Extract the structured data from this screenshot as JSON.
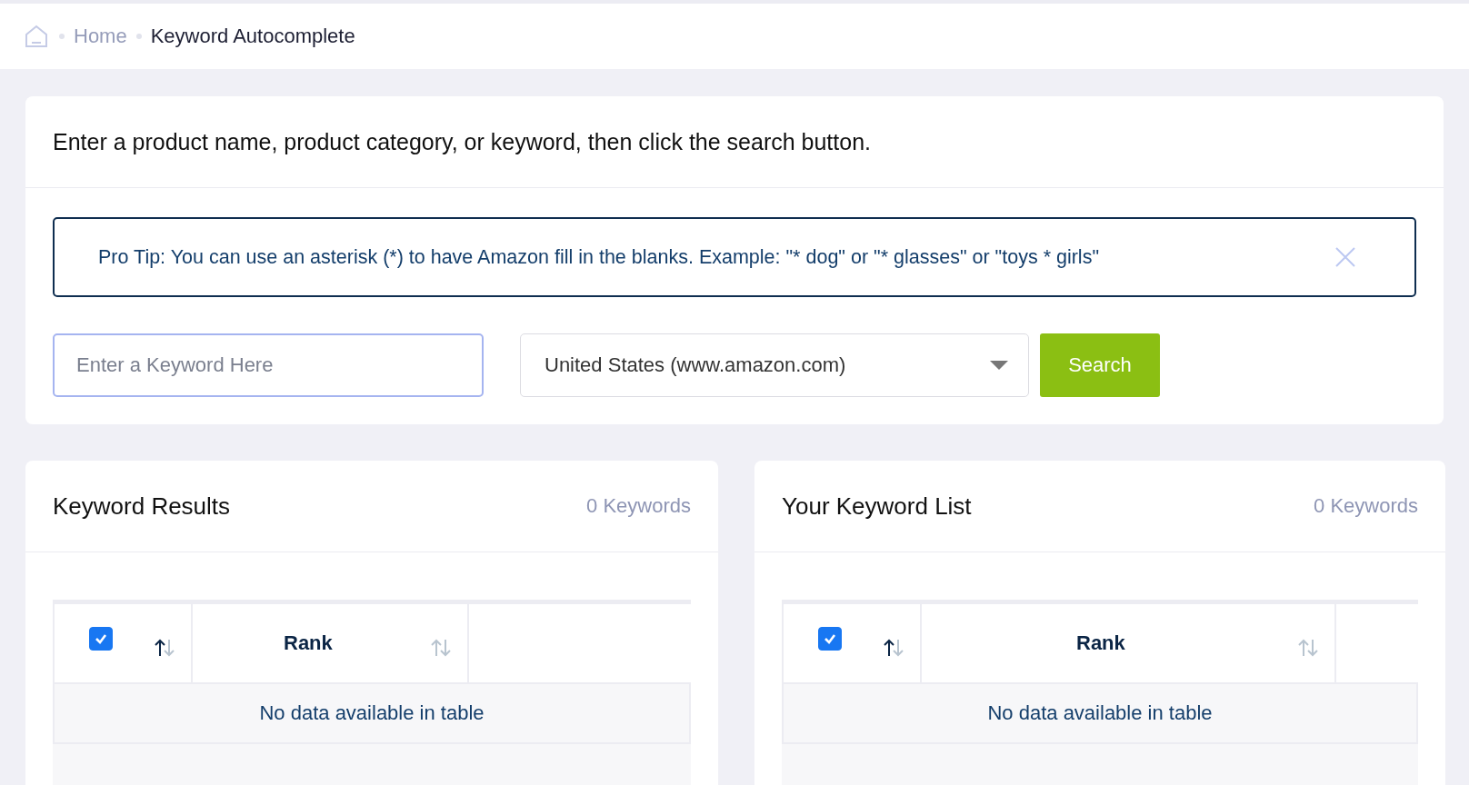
{
  "breadcrumb": {
    "items": [
      {
        "label": "Home",
        "selected": false
      },
      {
        "label": "Keyword Autocomplete",
        "selected": true
      }
    ]
  },
  "search_card": {
    "title": "Enter a product name, product category, or keyword, then click the search button.",
    "tip": "Pro Tip: You can use an asterisk (*) to have Amazon fill in the blanks. Example: \"* dog\" or \"* glasses\" or \"toys * girls\"",
    "keyword_field": {
      "placeholder": "Enter a Keyword Here"
    },
    "marketplace": "United States (www.amazon.com)",
    "search_button": "Search"
  },
  "panels": [
    {
      "title": "Keyword Results",
      "count": "0 Keywords",
      "select_all_checked": true,
      "select_sorted": true,
      "columns": [
        {
          "label": "Rank",
          "sorted": false
        }
      ],
      "empty_message": "No data available in table"
    },
    {
      "title": "Your Keyword List",
      "count": "0 Keywords",
      "select_all_checked": true,
      "select_sorted": true,
      "columns": [
        {
          "label": "Rank",
          "sorted": false
        }
      ],
      "empty_message": "No data available in table"
    }
  ]
}
